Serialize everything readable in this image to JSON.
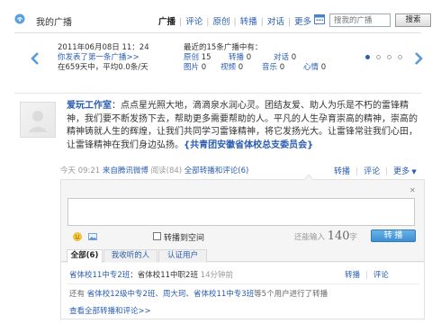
{
  "header": {
    "title": "我的广播",
    "nav": [
      "广播",
      "评论",
      "原创",
      "转播",
      "对话"
    ],
    "more": "更多",
    "search_placeholder": "搜我的广播",
    "search_button": "搜索"
  },
  "stats": {
    "date": "2011年06月08日 11：24",
    "first_broadcast": "你发表了第一条广播>>",
    "summary": "在659天中，平均0.0条/天",
    "recent": "最近的15条广播中有：",
    "rows": [
      [
        {
          "label": "原创",
          "value": "15"
        },
        {
          "label": "转播",
          "value": "0"
        },
        {
          "label": "对话",
          "value": "0"
        }
      ],
      [
        {
          "label": "图片",
          "value": "0"
        },
        {
          "label": "视频",
          "value": "0"
        },
        {
          "label": "音乐",
          "value": "0"
        },
        {
          "label": "心情",
          "value": "0"
        }
      ]
    ],
    "active_page": 1,
    "page_count": 4
  },
  "post": {
    "author": "爱玩工作室",
    "text": "：点点星光照大地，滴滴泉水润心灵。团结友爱、助人为乐是不朽的雷锋精神，我们要不断发扬下去，帮助更多需要帮助的人。平凡的人生孕育崇高的精神，崇高的精神铸就人生的辉煌，让我们共同学习雷锋精神，将它发扬光大。让雷锋常驻我们心田，让雷锋精神在我们身边弘扬。",
    "group": "{共青团安徽省体校总支委员会}",
    "meta": {
      "time": "今天 09:21",
      "source": "来自腾讯微博",
      "reads": "阅读(84)",
      "all_reposts": "全部转播和评论(6)"
    },
    "actions": {
      "repost": "转播",
      "comment": "评论",
      "more": "更多"
    }
  },
  "panel": {
    "checkbox_label": "转播到空间",
    "char_count_prefix": "还能输入",
    "char_count": "140",
    "char_count_suffix": "字",
    "repost_button": "转 播",
    "tabs": [
      "全部(6)",
      "我收听的人",
      "认证用户"
    ],
    "row1": {
      "user": "省体校11中专2班",
      "text": "：省体校11中职2班",
      "time": "14分钟前",
      "repost": "转播",
      "comment": "评论"
    },
    "row2": {
      "prefix": "还有",
      "users": "省体校12级中专2班、周大珂、省体校11中专3班",
      "suffix": "等5个用户进行了转播"
    },
    "view_all": "查看全部转播和评论>>"
  }
}
